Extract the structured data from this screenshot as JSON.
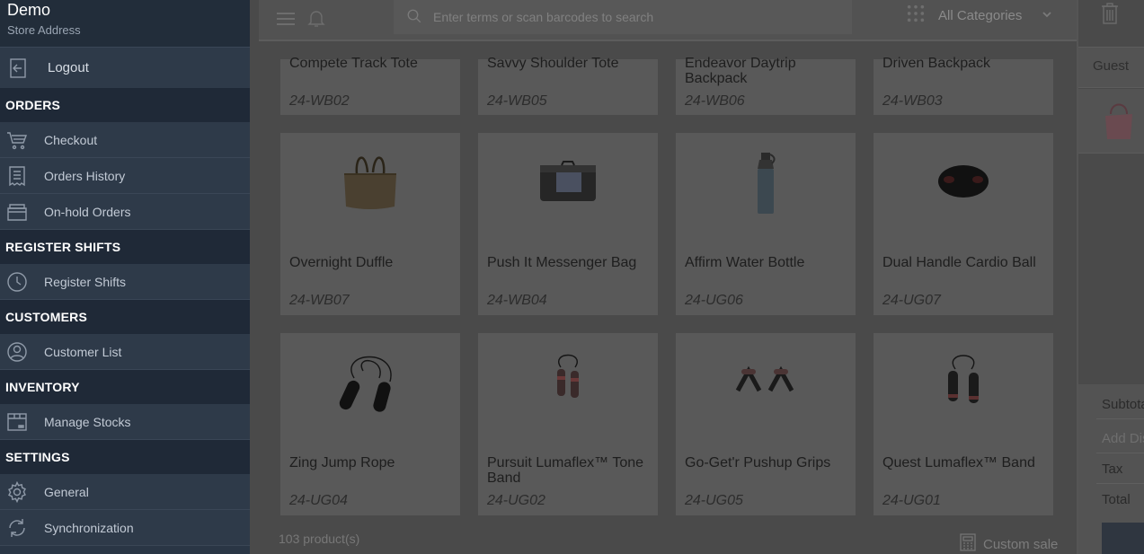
{
  "sidebar": {
    "store_name": "Demo",
    "store_address": "Store Address",
    "logout_label": "Logout",
    "sections": [
      {
        "title": "ORDERS",
        "items": [
          {
            "label": "Checkout",
            "icon": "cart-icon"
          },
          {
            "label": "Orders History",
            "icon": "receipt-icon"
          },
          {
            "label": "On-hold Orders",
            "icon": "hold-box-icon"
          }
        ]
      },
      {
        "title": "REGISTER SHIFTS",
        "items": [
          {
            "label": "Register Shifts",
            "icon": "clock-icon"
          }
        ]
      },
      {
        "title": "CUSTOMERS",
        "items": [
          {
            "label": "Customer List",
            "icon": "user-icon"
          }
        ]
      },
      {
        "title": "INVENTORY",
        "items": [
          {
            "label": "Manage Stocks",
            "icon": "stock-box-icon"
          }
        ]
      },
      {
        "title": "SETTINGS",
        "items": [
          {
            "label": "General",
            "icon": "gear-icon"
          },
          {
            "label": "Synchronization",
            "icon": "sync-icon"
          }
        ]
      }
    ]
  },
  "toolbar": {
    "search_placeholder": "Enter terms or scan barcodes to search",
    "category_label": "All Categories"
  },
  "products": [
    {
      "name": "Compete Track Tote",
      "sku": "24-WB02"
    },
    {
      "name": "Savvy Shoulder Tote",
      "sku": "24-WB05"
    },
    {
      "name": "Endeavor Daytrip Backpack",
      "sku": "24-WB06"
    },
    {
      "name": "Driven Backpack",
      "sku": "24-WB03"
    },
    {
      "name": "Overnight Duffle",
      "sku": "24-WB07"
    },
    {
      "name": "Push It Messenger Bag",
      "sku": "24-WB04"
    },
    {
      "name": "Affirm Water Bottle",
      "sku": "24-UG06"
    },
    {
      "name": "Dual Handle Cardio Ball",
      "sku": "24-UG07"
    },
    {
      "name": "Zing Jump Rope",
      "sku": "24-UG04"
    },
    {
      "name": "Pursuit Lumaflex™ Tone Band",
      "sku": "24-UG02"
    },
    {
      "name": "Go-Get'r Pushup Grips",
      "sku": "24-UG05"
    },
    {
      "name": "Quest Lumaflex™ Band",
      "sku": "24-UG01"
    }
  ],
  "footer": {
    "product_count": "103 product(s)",
    "custom_sale_label": "Custom sale"
  },
  "cart": {
    "customer_label": "Guest",
    "subtotal_label": "Subtotal",
    "discount_label": "Add Discount",
    "tax_label": "Tax",
    "total_label": "Total"
  }
}
